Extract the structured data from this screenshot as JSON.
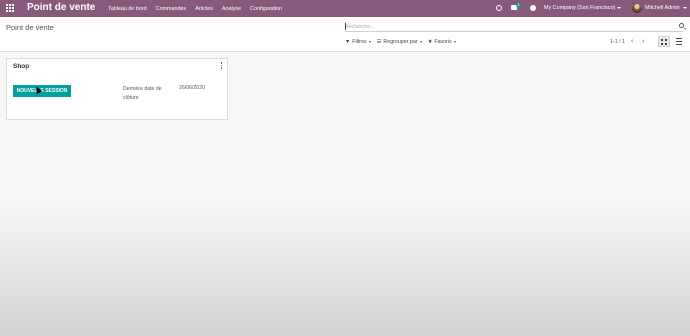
{
  "navbar": {
    "app_title": "Point de vente",
    "menu": [
      "Tableau de bord",
      "Commandes",
      "Articles",
      "Analyse",
      "Configuration"
    ],
    "chat_count": "2",
    "company": "My Company (San Francisco)",
    "user": "Mitchell Admin"
  },
  "control_panel": {
    "breadcrumb": "Point de vente",
    "search_placeholder": "Recherche...",
    "filters_label": "Filtres",
    "group_by_label": "Regrouper par",
    "favorites_label": "Favoris",
    "pager": "1-1 / 1",
    "pager_prev": "‹",
    "pager_next": "›"
  },
  "card": {
    "title": "Shop",
    "new_session_label": "NOUVELLE SESSION",
    "last_close_label": "Dernière date de clôture",
    "last_close_date": "26/06/2020"
  },
  "colors": {
    "brand": "#875a7b",
    "primary_button": "#00a09d"
  }
}
